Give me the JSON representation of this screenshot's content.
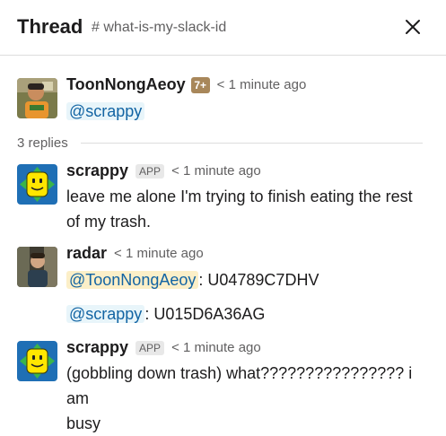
{
  "header": {
    "title": "Thread",
    "channel_hash": "#",
    "channel": "what-is-my-slack-id"
  },
  "parent": {
    "author": "ToonNongAeoy",
    "badge": "7+",
    "time": "< 1 minute ago",
    "mention": "@scrappy"
  },
  "replies_label": "3 replies",
  "replies": [
    {
      "author": "scrappy",
      "badge": "APP",
      "time": "< 1 minute ago",
      "text_line1": "leave me alone I'm trying to finish eating the rest",
      "text_line2": "of my trash."
    },
    {
      "author": "radar",
      "time": "< 1 minute ago",
      "line1_mention": "@ToonNongAeoy",
      "line1_rest": ": U04789C7DHV",
      "line2_mention": "@scrappy",
      "line2_rest": ": U015D6A36AG"
    },
    {
      "author": "scrappy",
      "badge": "APP",
      "time": "< 1 minute ago",
      "text_line1": "(gobbling down trash) what???????????????? i am",
      "text_line2": "busy"
    }
  ],
  "colors": {
    "mention_text": "#1264a3",
    "mention_bg": "#e8f5fa",
    "self_mention_bg": "#fcefc8",
    "scrappy_avatar_bg": "#1f6fb5",
    "scrappy_arrows": "#3ab54a",
    "scrappy_face": "#ffe600"
  }
}
